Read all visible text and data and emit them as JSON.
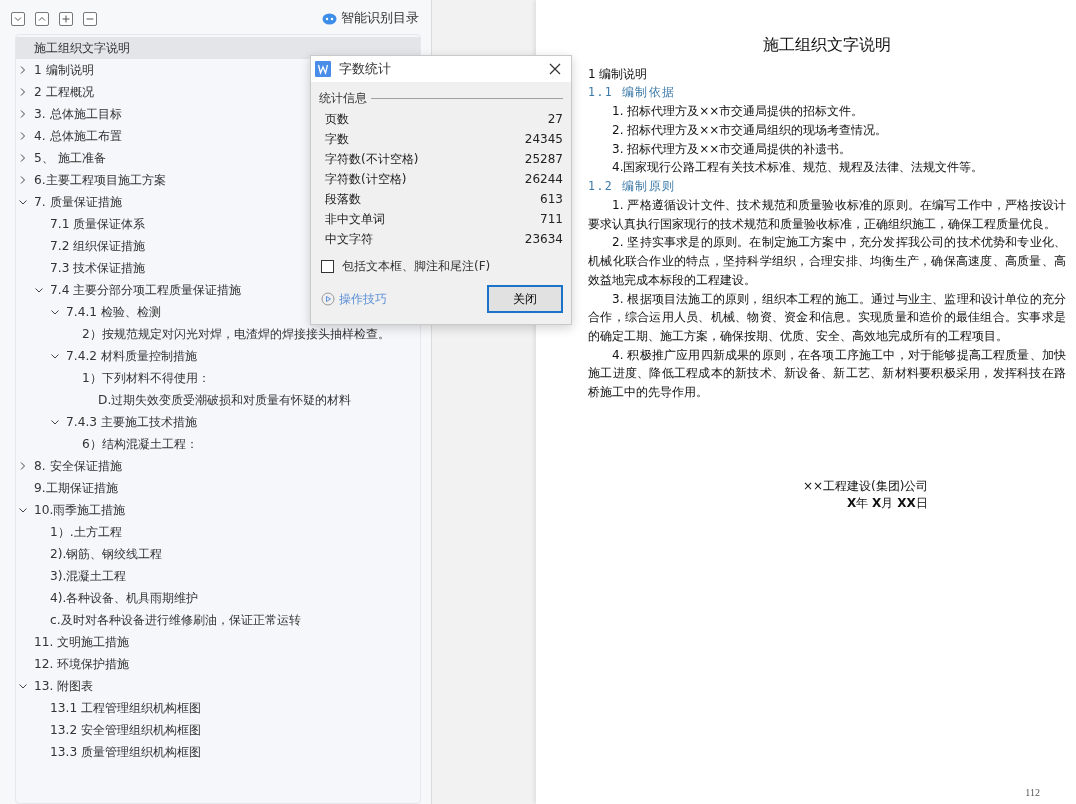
{
  "panel": {
    "smart_toc_button": {
      "label": "智能识别目录"
    }
  },
  "outline": [
    {
      "label": "施工组织文字说明",
      "selected": true
    },
    {
      "label": "1 编制说明",
      "selected": false,
      "expanded": false
    },
    {
      "label": "2 工程概况",
      "selected": false,
      "expanded": false
    },
    {
      "label": "3.  总体施工目标",
      "selected": false,
      "expanded": false
    },
    {
      "label": "4.  总体施工布置",
      "selected": false,
      "expanded": false
    },
    {
      "label": "5、 施工准备",
      "selected": false,
      "expanded": false
    },
    {
      "label": "6.主要工程项目施工方案",
      "selected": false,
      "expanded": false
    },
    {
      "label": "7.  质量保证措施",
      "selected": false,
      "expanded": true,
      "children": [
        {
          "label": "7.1 质量保证体系",
          "selected": false
        },
        {
          "label": "7.2 组织保证措施",
          "selected": false
        },
        {
          "label": "7.3 技术保证措施",
          "selected": false
        },
        {
          "label": "7.4 主要分部分项工程质量保证措施",
          "selected": false,
          "expanded": true,
          "children": [
            {
              "label": "7.4.1 检验、检测",
              "selected": false,
              "expanded": true,
              "children": [
                {
                  "label": "2）按规范规定对闪光对焊，电渣焊的焊接接头抽样检查。",
                  "selected": false
                }
              ]
            },
            {
              "label": "7.4.2  材料质量控制措施",
              "selected": false,
              "expanded": true,
              "children": [
                {
                  "label": "1）下列材料不得使用：",
                  "selected": false,
                  "children": [
                    {
                      "label": "D.过期失效变质受潮破损和对质量有怀疑的材料",
                      "selected": false
                    }
                  ]
                }
              ]
            },
            {
              "label": "7.4.3 主要施工技术措施",
              "selected": false,
              "expanded": true,
              "children": [
                {
                  "label": "6）结构混凝土工程：",
                  "selected": false
                }
              ]
            }
          ]
        }
      ]
    },
    {
      "label": "8.  安全保证措施",
      "selected": false,
      "expanded": false
    },
    {
      "label": "9.工期保证措施",
      "selected": false
    },
    {
      "label": "10.雨季施工措施",
      "selected": false,
      "expanded": true,
      "children": [
        {
          "label": "1）.土方工程",
          "selected": false
        },
        {
          "label": "2).钢筋、钢绞线工程",
          "selected": false
        },
        {
          "label": "3).混凝土工程",
          "selected": false
        },
        {
          "label": "4).各种设备、机具雨期维护",
          "selected": false
        },
        {
          "label": "c.及时对各种设备进行维修刷油，保证正常运转",
          "selected": false
        }
      ]
    },
    {
      "label": "11.  文明施工措施",
      "selected": false
    },
    {
      "label": "12.  环境保护措施",
      "selected": false
    },
    {
      "label": "13.  附图表",
      "selected": false,
      "expanded": true,
      "children": [
        {
          "label": "13.1 工程管理组织机构框图",
          "selected": false
        },
        {
          "label": "13.2  安全管理组织机构框图",
          "selected": false
        },
        {
          "label": "13.3  质量管理组织机构框图",
          "selected": false
        }
      ]
    }
  ],
  "dialog": {
    "title": "字数统计",
    "section": "统计信息",
    "stats": [
      {
        "label": "页数",
        "value": "27"
      },
      {
        "label": "字数",
        "value": "24345"
      },
      {
        "label": "字符数(不计空格)",
        "value": "25287"
      },
      {
        "label": "字符数(计空格)",
        "value": "26244"
      },
      {
        "label": "段落数",
        "value": "613"
      },
      {
        "label": "非中文单词",
        "value": "711"
      },
      {
        "label": "中文字符",
        "value": "23634"
      }
    ],
    "include_checkbox": {
      "label": "包括文本框、脚注和尾注(F)",
      "checked": false
    },
    "tips_link": "操作技巧",
    "close_button": "关闭"
  },
  "document": {
    "title": "施工组织文字说明",
    "blocks": [
      {
        "kind": "heading1",
        "text": "1 编制说明"
      },
      {
        "kind": "heading2",
        "text": "1.1 编制依据"
      },
      {
        "kind": "para",
        "text": "1. 招标代理方及××市交通局提供的招标文件。"
      },
      {
        "kind": "para",
        "text": "2. 招标代理方及××市交通局组织的现场考查情况。"
      },
      {
        "kind": "para",
        "text": "3. 招标代理方及××市交通局提供的补遗书。"
      },
      {
        "kind": "para",
        "text": "4.国家现行公路工程有关技术标准、规范、规程及法律、法规文件等。"
      },
      {
        "kind": "heading2",
        "text": "1.2 编制原则"
      },
      {
        "kind": "para",
        "text": "1. 严格遵循设计文件、技术规范和质量验收标准的原则。在编写工作中，严格按设计要求认真执行国家现行的技术规范和质量验收标准，正确组织施工，确保工程质量优良。"
      },
      {
        "kind": "para",
        "text": "2. 坚持实事求是的原则。在制定施工方案中，充分发挥我公司的技术优势和专业化、机械化联合作业的特点，坚持科学组织，合理安排、均衡生产，确保高速度、高质量、高效益地完成本标段的工程建设。"
      },
      {
        "kind": "para",
        "text": "3. 根据项目法施工的原则，组织本工程的施工。通过与业主、监理和设计单位的充分合作，综合运用人员、机械、物资、资金和信息。实现质量和造价的最佳组合。实事求是的确定工期、施工方案，确保按期、优质、安全、高效地完成所有的工程项目。"
      },
      {
        "kind": "para",
        "text": "4. 积极推广应用四新成果的原则，在各项工序施工中，对于能够提高工程质量、加快施工进度、降低工程成本的新技术、新设备、新工艺、新材料要积极采用，发挥科技在路桥施工中的先导作用。"
      }
    ],
    "signature": {
      "company": "××工程建设(集团)公司",
      "date": "**X**年 **X**月 **XX**日"
    },
    "page_number": "112"
  }
}
